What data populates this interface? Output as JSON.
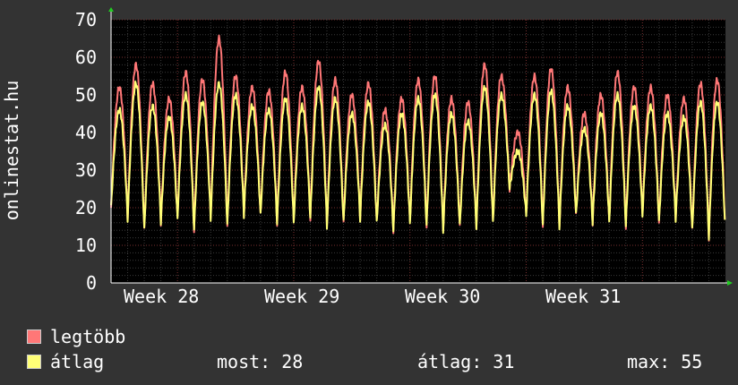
{
  "chart_data": {
    "type": "line",
    "ylabel": "onlinestat.hu",
    "ylim": [
      0,
      70
    ],
    "yticks": [
      0,
      10,
      20,
      30,
      40,
      50,
      60,
      70
    ],
    "xticks": [
      "Week 28",
      "Week 29",
      "Week 30",
      "Week 31"
    ],
    "grid": true,
    "legend_placement": "bottom",
    "series": [
      {
        "name": "legtöbb",
        "color": "#ff7777",
        "daily_peaks": [
          52,
          58,
          53,
          49,
          56,
          54,
          65,
          55,
          52,
          51,
          56,
          52,
          59,
          54,
          50,
          53,
          46,
          49,
          54,
          55,
          49,
          48,
          58,
          55,
          40,
          55,
          57,
          52,
          45,
          50,
          56,
          52,
          52,
          50,
          49,
          53,
          54
        ],
        "daily_troughs": [
          20,
          17,
          14,
          16,
          17,
          14,
          17,
          15,
          18,
          18,
          16,
          16,
          17,
          15,
          16,
          17,
          16,
          14,
          16,
          15,
          14,
          15,
          15,
          16,
          25,
          18,
          15,
          15,
          18,
          16,
          16,
          15,
          18,
          16,
          17,
          14,
          12
        ]
      },
      {
        "name": "átlag",
        "color": "#ffff77",
        "daily_peaks": [
          46,
          53,
          47,
          44,
          50,
          48,
          53,
          50,
          47,
          46,
          49,
          47,
          52,
          49,
          45,
          48,
          42,
          45,
          49,
          50,
          45,
          43,
          52,
          50,
          35,
          50,
          51,
          47,
          41,
          45,
          50,
          47,
          47,
          45,
          44,
          48,
          48
        ],
        "daily_troughs": [
          20,
          17,
          14,
          16,
          17,
          14,
          17,
          15,
          18,
          18,
          16,
          16,
          17,
          15,
          16,
          17,
          16,
          14,
          16,
          15,
          14,
          15,
          15,
          16,
          25,
          18,
          15,
          15,
          18,
          16,
          16,
          15,
          18,
          16,
          17,
          14,
          12
        ]
      }
    ]
  },
  "legend": {
    "max_label": "legtöbb",
    "avg_label": "átlag",
    "max_color": "#ff7777",
    "avg_color": "#ffff77"
  },
  "stats": {
    "now_label": "most: 28",
    "avg_label": "átlag: 31",
    "max_label": "max: 55"
  }
}
